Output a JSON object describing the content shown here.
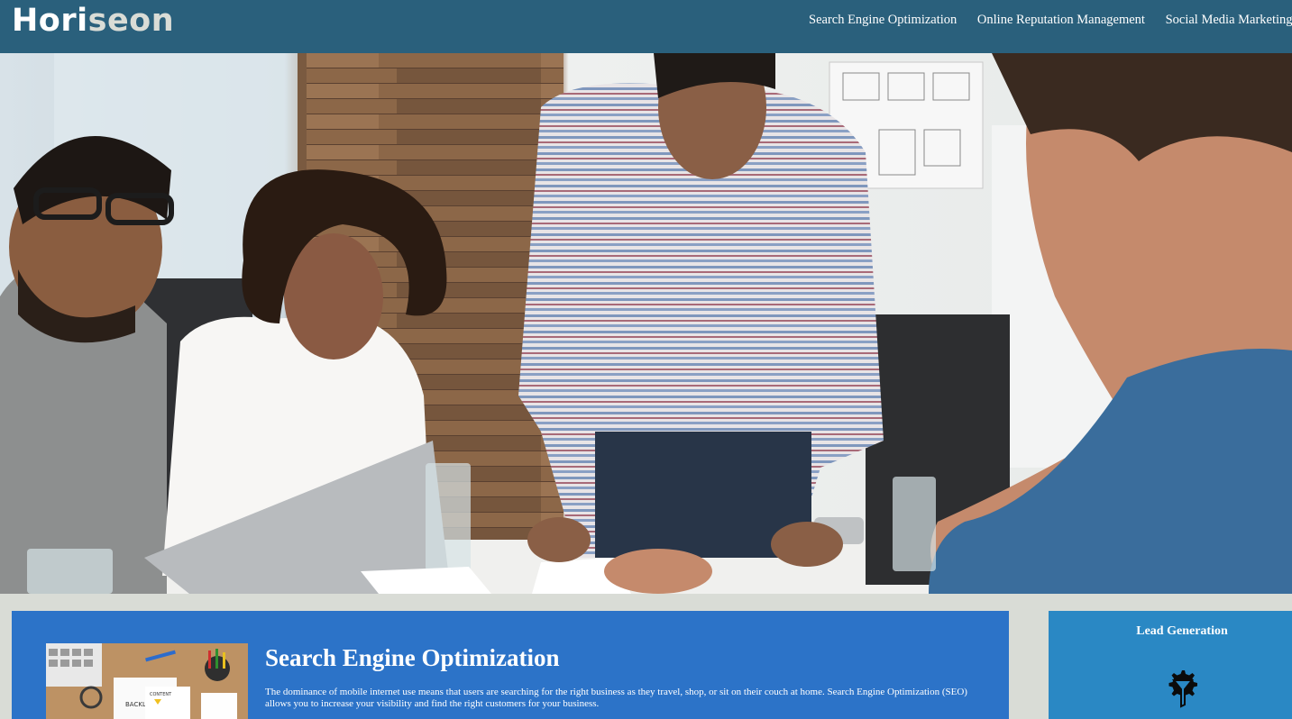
{
  "header": {
    "logo_part1": "Hori",
    "logo_part2": "seon",
    "nav": [
      {
        "label": "Search Engine Optimization"
      },
      {
        "label": "Online Reputation Management"
      },
      {
        "label": "Social Media Marketing"
      }
    ]
  },
  "hero": {
    "icon": "team-meeting-photo"
  },
  "content": {
    "title": "Search Engine Optimization",
    "text": "The dominance of mobile internet use means that users are searching for the right business as they travel, shop, or sit on their couch at home. Search Engine Optimization (SEO) allows you to increase your visibility and find the right customers for your business.",
    "image_icon": "seo-desk-photo"
  },
  "sidebar": {
    "title": "Lead Generation",
    "icon": "lead-generation-icon"
  },
  "colors": {
    "header_bg": "#2a607c",
    "page_bg": "#d9dcd6",
    "card_bg": "#2c73c8",
    "side_bg": "#2a88c4",
    "logo_accent": "#d9dcd6"
  }
}
